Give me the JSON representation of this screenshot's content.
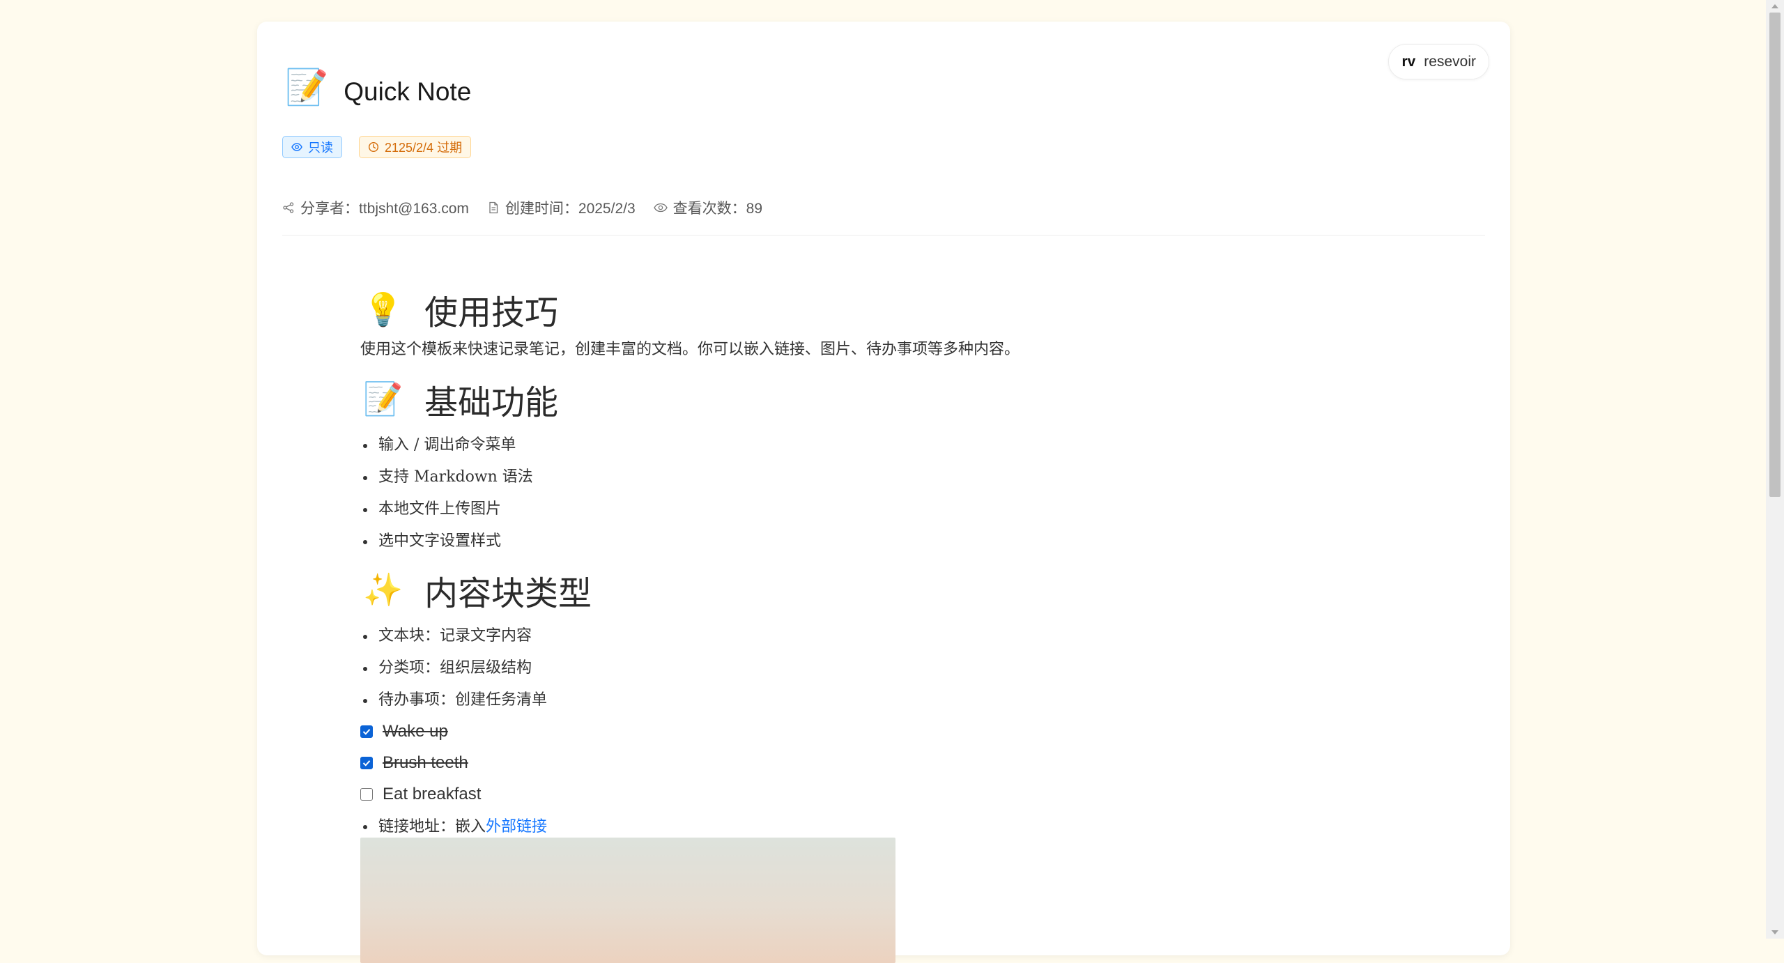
{
  "user": {
    "avatar": "rv",
    "name": "resevoir"
  },
  "note": {
    "icon": "📝",
    "title": "Quick Note",
    "tags": {
      "readonly": "只读",
      "expiry": "2125/2/4 过期"
    },
    "meta": {
      "sharer": "分享者：ttbjsht@163.com",
      "created": "创建时间：2025/2/3",
      "views": "查看次数：89"
    }
  },
  "doc": {
    "tips": {
      "icon": "💡",
      "heading": "使用技巧",
      "text": "使用这个模板来快速记录笔记，创建丰富的文档。你可以嵌入链接、图片、待办事项等多种内容。"
    },
    "basic": {
      "icon": "📝",
      "heading": "基础功能",
      "items": [
        "输入 / 调出命令菜单",
        "支持 Markdown 语法",
        "本地文件上传图片",
        "选中文字设置样式"
      ]
    },
    "blocks": {
      "icon": "✨",
      "heading": "内容块类型",
      "items": [
        "文本块：记录文字内容",
        "分类项：组织层级结构",
        "待办事项：创建任务清单"
      ]
    },
    "todos": [
      {
        "text": "Wake up",
        "checked": true
      },
      {
        "text": "Brush teeth",
        "checked": true
      },
      {
        "text": "Eat breakfast",
        "checked": false
      }
    ],
    "link_item": {
      "prefix": "链接地址：嵌入",
      "link": "外部链接"
    }
  },
  "colors": {
    "page_bg": "#fffbee",
    "accent": "#1677ff",
    "expiry": "#d46b08",
    "checkbox": "#0b63d6"
  }
}
